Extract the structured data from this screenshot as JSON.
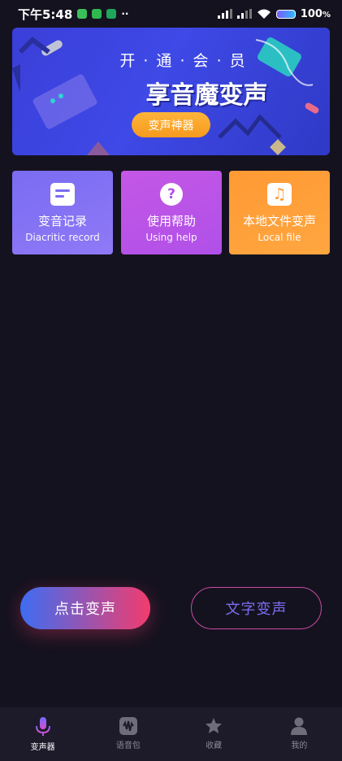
{
  "status": {
    "time": "下午5:48",
    "battery": "100",
    "battery_unit": "%"
  },
  "banner": {
    "small_title": "开 · 通 · 会 · 员",
    "big_title": "享音魔变声",
    "button": "变声神器"
  },
  "cards": [
    {
      "title": "变音记录",
      "subtitle": "Diacritic record",
      "icon": "document-icon",
      "color_from": "#7a6cf2",
      "color_to": "#8f79f6"
    },
    {
      "title": "使用帮助",
      "subtitle": "Using help",
      "icon": "help-icon",
      "color_from": "#c457e6",
      "color_to": "#b050e8"
    },
    {
      "title": "本地文件变声",
      "subtitle": "Local file",
      "icon": "music-note-icon",
      "color_from": "#ff9a34",
      "color_to": "#ffa640"
    }
  ],
  "actions": {
    "voice": "点击变声",
    "text": "文字变声"
  },
  "tabs": [
    {
      "label": "变声器",
      "icon": "microphone-icon",
      "active": true
    },
    {
      "label": "语音包",
      "icon": "audio-wave-icon",
      "active": false
    },
    {
      "label": "收藏",
      "icon": "star-icon",
      "active": false
    },
    {
      "label": "我的",
      "icon": "person-icon",
      "active": false
    }
  ]
}
